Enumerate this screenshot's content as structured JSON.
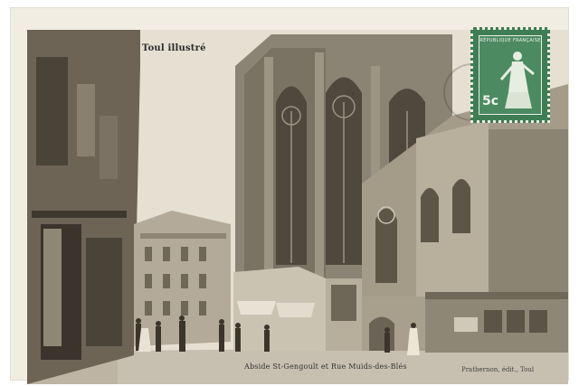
{
  "postcard": {
    "series_title": "Toul illustré",
    "caption": "Abside St-Gengoult et Rue Muids-des-Blés",
    "publisher": "Pratbernon, édit., Toul"
  },
  "stamp": {
    "country_text": "RÉPUBLIQUE FRANÇAISE",
    "value": "5c"
  },
  "colors": {
    "card": "#f1ede3",
    "photo_tone": "#d8d1c2",
    "stamp_green": "#3f7d55"
  }
}
